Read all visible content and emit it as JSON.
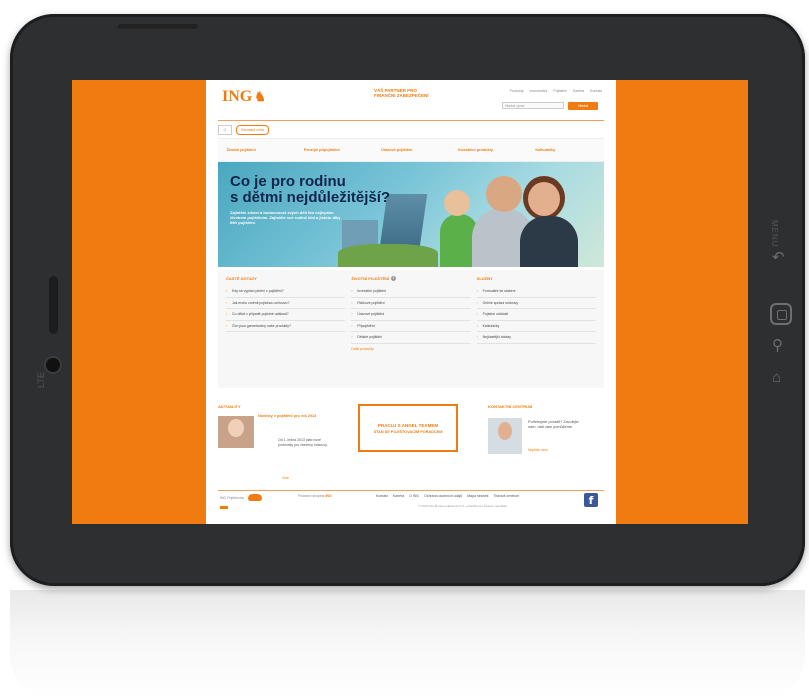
{
  "device": {
    "brand_label": "LTE",
    "menu_label": "MENU",
    "icons": [
      "back-icon",
      "home-icon",
      "search-icon",
      "bookmark-icon"
    ]
  },
  "header": {
    "logo": "ING",
    "tagline": "VÁŠ PARTNER PRO FINANČNÍ ZABEZPEČENÍ",
    "topnav": [
      "Produkty",
      "Investování",
      "Pojištění",
      "Kariéra",
      "Kontakt"
    ],
    "search_placeholder": "Hledat výraz",
    "search_button": "Hledat"
  },
  "tabs": {
    "home": "⌂",
    "client_zone": "Klientská zóna"
  },
  "mainnav": [
    "Životní pojištění",
    "Penzijní připojištění",
    "Úrazové pojištění",
    "Investiční produkty",
    "Kalkulačky"
  ],
  "hero": {
    "title_line1": "Co je pro rodinu",
    "title_line2": "s dětmi nejdůležitější?",
    "text": "Zajistěte zdraví a budoucnost svých dětí tím nejlepším životním pojištěním. Zajistěte své rodině klid a jistotu díky ING pojištění."
  },
  "columns": [
    {
      "heading": "ČASTÉ DOTAZY",
      "items": [
        "Kdy se vyplácí plnění z pojištění?",
        "Jak mohu změnit pojistnou smlouvu?",
        "Co dělat v případě pojistné události?",
        "Čím jsou garantovány naše produkty?"
      ]
    },
    {
      "heading": "ŽIVOTNÍ POJIŠTĚNÍ",
      "items": [
        "Investiční pojištění",
        "Rizikové pojištění",
        "Úrazové pojištění",
        "Připojištění",
        "Dětské pojištění"
      ],
      "more": "Další produkty"
    },
    {
      "heading": "SLUŽBY",
      "items": [
        "Formuláře ke stažení",
        "Online správa smlouvy",
        "Pojistné události",
        "Kalkulačky",
        "Nejčastější dotazy"
      ]
    }
  ],
  "news": {
    "heading": "AKTUALITY",
    "title": "Novinky v pojištění pro rok 2013",
    "text": "Od 1. ledna 2013 platí nové podmínky pro všechny smlouvy.",
    "more": "Více"
  },
  "promo": {
    "line1": "PRACUJ S ANGEL TEAMEM",
    "line2": "STAŇ SE POJIŠŤOVACÍM PORADCEM"
  },
  "contact": {
    "heading": "KONTAKTNÍ CENTRUM",
    "text": "Potřebujete poradit? Zavolejte nám, rádi vám pomůžeme.",
    "link": "Napište nám"
  },
  "footer": {
    "left": "ING Pojišťovna",
    "mid_label": "Finanční skupina",
    "mid_brand": "ING",
    "nav": [
      "Kontakt",
      "Kariéra",
      "O ING",
      "Ochrana osobních údajů",
      "Mapa stránek",
      "Tisková centrum"
    ],
    "copyright": "© 2013 ING Životní pojišťovna N.V., pobočka pro Českou republiku"
  },
  "colors": {
    "accent": "#f07c11",
    "hero_title": "#10254a",
    "device": "#2e2f31",
    "facebook": "#3b5998"
  }
}
